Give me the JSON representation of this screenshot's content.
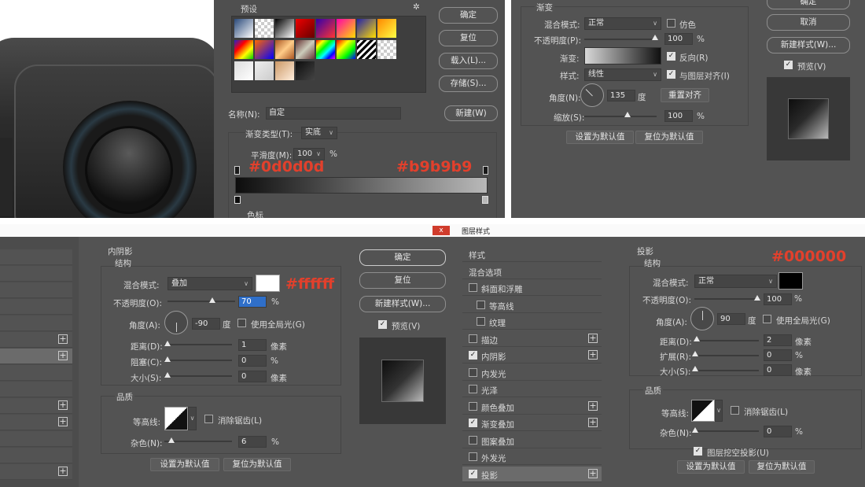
{
  "gradient_editor": {
    "presets_label": "预设",
    "ok": "确定",
    "reset": "复位",
    "load": "载入(L)...",
    "save": "存储(S)...",
    "name_label": "名称(N):",
    "name_value": "自定",
    "new_button": "新建(W)",
    "gradient_type_label": "渐变类型(T):",
    "gradient_type_value": "实底",
    "smoothness_label": "平滑度(M):",
    "smoothness_value": "100",
    "smoothness_unit": "%",
    "stop_left_hex": "#0d0d0d",
    "stop_right_hex": "#b9b9b9",
    "color_stop_label": "色标"
  },
  "gradient_overlay": {
    "section_title": "渐变",
    "blend_mode_label": "混合模式:",
    "blend_mode_value": "正常",
    "dither_label": "仿色",
    "opacity_label": "不透明度(P):",
    "opacity_value": "100",
    "opacity_unit": "%",
    "gradient_label": "渐变:",
    "reverse_label": "反向(R)",
    "style_label": "样式:",
    "style_value": "线性",
    "align_label": "与图层对齐(I)",
    "angle_label": "角度(N):",
    "angle_value": "135",
    "angle_unit": "度",
    "reset_align": "重置对齐",
    "scale_label": "缩放(S):",
    "scale_value": "100",
    "scale_unit": "%",
    "make_default": "设置为默认值",
    "reset_default": "复位为默认值",
    "ok": "确定",
    "cancel": "取消",
    "new_style": "新建样式(W)...",
    "preview": "预览(V)"
  },
  "inner_shadow": {
    "section_title": "内阴影",
    "structure": "结构",
    "blend_mode_label": "混合模式:",
    "blend_mode_value": "叠加",
    "color_hex": "#ffffff",
    "opacity_label": "不透明度(O):",
    "opacity_value": "70",
    "opacity_unit": "%",
    "angle_label": "角度(A):",
    "angle_value": "-90",
    "angle_unit": "度",
    "global_light": "使用全局光(G)",
    "distance_label": "距离(D):",
    "distance_value": "1",
    "distance_unit": "像素",
    "choke_label": "阻塞(C):",
    "choke_value": "0",
    "choke_unit": "%",
    "size_label": "大小(S):",
    "size_value": "0",
    "size_unit": "像素",
    "quality": "品质",
    "contour_label": "等高线:",
    "anti_alias": "消除锯齿(L)",
    "noise_label": "杂色(N):",
    "noise_value": "6",
    "noise_unit": "%",
    "make_default": "设置为默认值",
    "reset_default": "复位为默认值",
    "ok": "确定",
    "reset": "复位",
    "new_style": "新建样式(W)...",
    "preview": "预览(V)"
  },
  "layer_style": {
    "window_title": "图层样式",
    "items": [
      {
        "label": "样式",
        "checkbox": false,
        "checked": false,
        "plus": false
      },
      {
        "label": "混合选项",
        "checkbox": false,
        "checked": false,
        "plus": false
      },
      {
        "label": "斜面和浮雕",
        "checkbox": true,
        "checked": false,
        "plus": false
      },
      {
        "label": "等高线",
        "checkbox": true,
        "checked": false,
        "plus": false
      },
      {
        "label": "纹理",
        "checkbox": true,
        "checked": false,
        "plus": false
      },
      {
        "label": "描边",
        "checkbox": true,
        "checked": false,
        "plus": true
      },
      {
        "label": "内阴影",
        "checkbox": true,
        "checked": true,
        "plus": true
      },
      {
        "label": "内发光",
        "checkbox": true,
        "checked": false,
        "plus": false
      },
      {
        "label": "光泽",
        "checkbox": true,
        "checked": false,
        "plus": false
      },
      {
        "label": "颜色叠加",
        "checkbox": true,
        "checked": false,
        "plus": true
      },
      {
        "label": "渐变叠加",
        "checkbox": true,
        "checked": true,
        "plus": true
      },
      {
        "label": "图案叠加",
        "checkbox": true,
        "checked": false,
        "plus": false
      },
      {
        "label": "外发光",
        "checkbox": true,
        "checked": false,
        "plus": false
      },
      {
        "label": "投影",
        "checkbox": true,
        "checked": true,
        "plus": true
      }
    ]
  },
  "drop_shadow": {
    "section_title": "投影",
    "structure": "结构",
    "color_hex": "#000000",
    "blend_mode_label": "混合模式:",
    "blend_mode_value": "正常",
    "opacity_label": "不透明度(O):",
    "opacity_value": "100",
    "opacity_unit": "%",
    "angle_label": "角度(A):",
    "angle_value": "90",
    "angle_unit": "度",
    "global_light": "使用全局光(G)",
    "distance_label": "距离(D):",
    "distance_value": "2",
    "distance_unit": "像素",
    "spread_label": "扩展(R):",
    "spread_value": "0",
    "spread_unit": "%",
    "size_label": "大小(S):",
    "size_value": "0",
    "size_unit": "像素",
    "quality": "品质",
    "contour_label": "等高线:",
    "anti_alias": "消除锯齿(L)",
    "noise_label": "杂色(N):",
    "noise_value": "0",
    "noise_unit": "%",
    "knockout": "图层挖空投影(U)",
    "make_default": "设置为默认值",
    "reset_default": "复位为默认值"
  }
}
